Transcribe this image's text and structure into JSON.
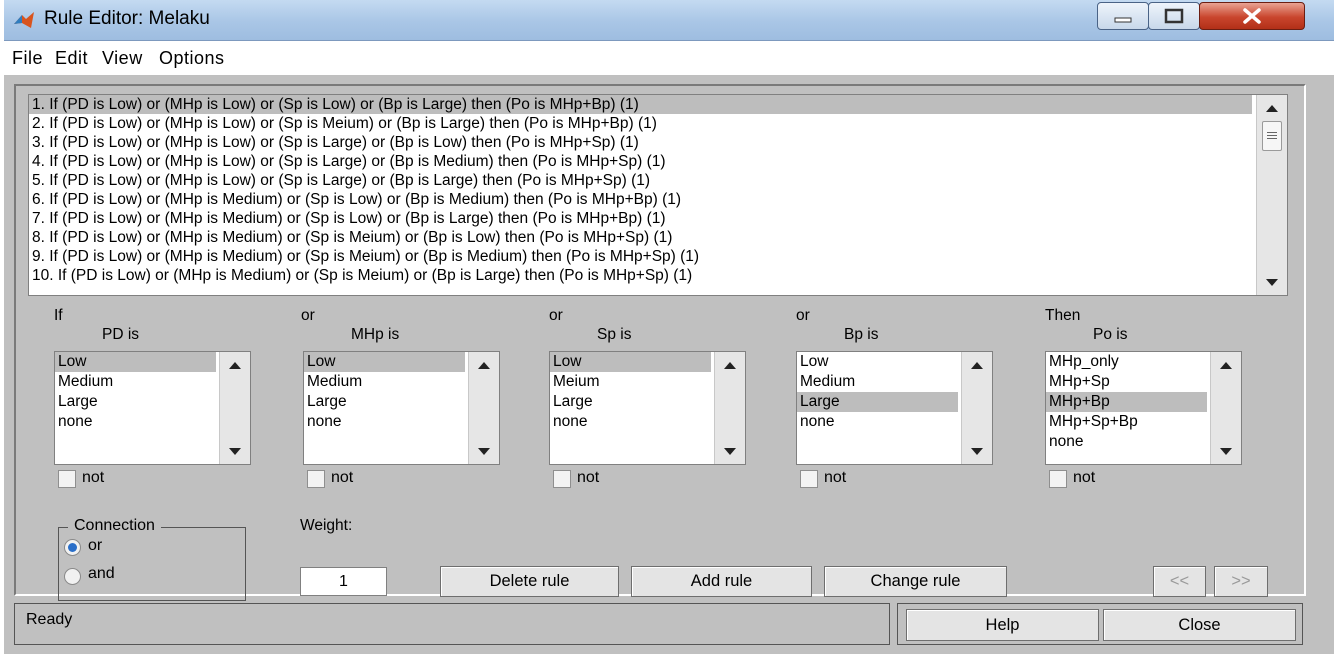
{
  "window": {
    "title": "Rule Editor: Melaku"
  },
  "menu": [
    "File",
    "Edit",
    "View",
    "Options"
  ],
  "rules": [
    "1. If (PD is Low) or (MHp is Low) or (Sp is Low) or (Bp is Large) then (Po is MHp+Bp) (1)",
    "2. If (PD is Low) or (MHp is Low) or (Sp is Meium) or (Bp is Large) then (Po is MHp+Bp) (1)",
    "3. If (PD is Low) or (MHp is Low) or (Sp is Large) or (Bp is Low) then (Po is MHp+Sp) (1)",
    "4. If (PD is Low) or (MHp is Low) or (Sp is Large) or (Bp is Medium) then (Po is MHp+Sp) (1)",
    "5. If (PD is Low) or (MHp is Low) or (Sp is Large) or (Bp is Large) then (Po is MHp+Sp) (1)",
    "6. If (PD is Low) or (MHp is Medium) or (Sp is Low) or (Bp is Medium) then (Po is MHp+Bp) (1)",
    "7. If (PD is Low) or (MHp is Medium) or (Sp is Low) or (Bp is Large) then (Po is MHp+Bp) (1)",
    "8. If (PD is Low) or (MHp is Medium) or (Sp is Meium) or (Bp is Low) then (Po is MHp+Sp) (1)",
    "9. If (PD is Low) or (MHp is Medium) or (Sp is Meium) or (Bp is Medium) then (Po is MHp+Sp) (1)",
    "10. If (PD is Low) or (MHp is Medium) or (Sp is Meium) or (Bp is Large) then (Po is MHp+Sp) (1)"
  ],
  "selected_rule_index": 0,
  "variables": [
    {
      "connector": "If",
      "label": "PD is",
      "options": [
        "Low",
        "Medium",
        "Large",
        "none"
      ],
      "selected": 0,
      "not_label": "not"
    },
    {
      "connector": "or",
      "label": "MHp is",
      "options": [
        "Low",
        "Medium",
        "Large",
        "none"
      ],
      "selected": 0,
      "not_label": "not"
    },
    {
      "connector": "or",
      "label": "Sp is",
      "options": [
        "Low",
        "Meium",
        "Large",
        "none"
      ],
      "selected": 0,
      "not_label": "not"
    },
    {
      "connector": "or",
      "label": "Bp is",
      "options": [
        "Low",
        "Medium",
        "Large",
        "none"
      ],
      "selected": 2,
      "not_label": "not"
    },
    {
      "connector": "Then",
      "label": "Po is",
      "options": [
        "MHp_only",
        "MHp+Sp",
        "MHp+Bp",
        "MHp+Sp+Bp",
        "none"
      ],
      "selected": 2,
      "not_label": "not"
    }
  ],
  "connection": {
    "title": "Connection",
    "options": [
      "or",
      "and"
    ],
    "selected": "or"
  },
  "weight": {
    "label": "Weight:",
    "value": "1"
  },
  "buttons": {
    "delete": "Delete rule",
    "add": "Add rule",
    "change": "Change rule",
    "prev": "<<",
    "next": ">>",
    "help": "Help",
    "close": "Close"
  },
  "status": "Ready",
  "colors": {
    "selection": "#bdbdbd",
    "panel": "#c0c0c0",
    "titlebar": "#a9c6e6",
    "close_button": "#c9452d"
  }
}
